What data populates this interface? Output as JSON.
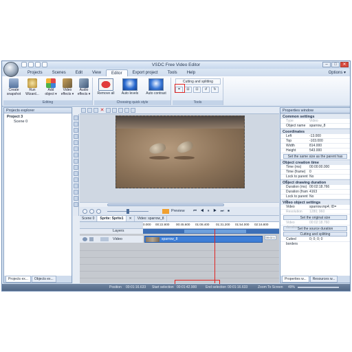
{
  "window": {
    "title": "VSDC Free Video Editor",
    "buttons": [
      "–",
      "□",
      "✕"
    ]
  },
  "menu": {
    "items": [
      "Projects",
      "Scenes",
      "Edit",
      "View",
      "Editor",
      "Export project",
      "Tools",
      "Help"
    ],
    "active": "Editor",
    "options": "Options ▾"
  },
  "ribbon": {
    "editing": {
      "name": "Editing",
      "buttons": [
        "Create snapshot",
        "Run Wizard...",
        "Add object ▾",
        "Video effects ▾",
        "Audio effects ▾"
      ]
    },
    "quick_style": {
      "name": "Choosing quick style",
      "buttons": [
        "Remove all",
        "Auto levels",
        "Auto contrast"
      ]
    },
    "tools": {
      "name": "Tools",
      "cutting": "Cutting and splitting"
    }
  },
  "projects_explorer": {
    "title": "Projects explorer",
    "tree": [
      "Project 3",
      "Scene 0"
    ],
    "tabs": [
      "Projects ex...",
      "Objects ex..."
    ]
  },
  "preview": {
    "label": "Preview"
  },
  "timeline": {
    "tabs": [
      "Scene 0",
      "Sprite: Sprite1",
      "Video: sparrow_8"
    ],
    "ruler": [
      "0.000",
      "00:22.800",
      "00:45.600",
      "01:08.400",
      "01:31.200",
      "01:54.000",
      "02:16.800"
    ],
    "cursor": "00:02:1",
    "layers_label": "Layers",
    "track_label": "Video",
    "clip_name": "sparrow_8"
  },
  "properties": {
    "title": "Properties window",
    "common": {
      "header": "Common settings",
      "rows": [
        {
          "k": "Type",
          "v": "Video",
          "dim": true
        },
        {
          "k": "Object name",
          "v": "sparrow_8",
          "dim": false
        }
      ]
    },
    "coords": {
      "header": "Coordinates",
      "rows": [
        {
          "k": "Left",
          "v": "-13.000"
        },
        {
          "k": "Top",
          "v": "-103.000"
        },
        {
          "k": "Width",
          "v": "814.000"
        },
        {
          "k": "Height",
          "v": "543.000"
        }
      ],
      "button": "Set the same size as the parent has"
    },
    "creation": {
      "header": "Object creation time",
      "rows": [
        {
          "k": "Time (ms)",
          "v": "00:00:00.000"
        },
        {
          "k": "Time (frame)",
          "v": "0"
        },
        {
          "k": "Lock to parent c",
          "v": "No"
        }
      ]
    },
    "duration": {
      "header": "Object drawing duration",
      "rows": [
        {
          "k": "Duration (ms)",
          "v": "00:02:18.766"
        },
        {
          "k": "Duration (fram",
          "v": "4163"
        },
        {
          "k": "Lock to parent c",
          "v": "No"
        }
      ]
    },
    "video": {
      "header": "Video object settings",
      "rows": [
        {
          "k": "Video",
          "v": "sparrow.mp4; ID=",
          "dim": false
        },
        {
          "k": "Resolution",
          "v": "1280; 960",
          "dim": true
        }
      ],
      "btn1": "Set the original size",
      "row2": {
        "k": "Video duration",
        "v": "00:02:18.760"
      },
      "btn2": "Set the source duration",
      "btn3": "Cutting and splitting",
      "row3": {
        "k": "Cutted borders",
        "v": "0; 0; 0; 0"
      }
    },
    "tabs": [
      "Properties w...",
      "Resources w..."
    ]
  },
  "statusbar": {
    "position": "Position",
    "position_val": "00:01:16.633",
    "start_sel": "Start selection",
    "start_val": "00:01:42.900",
    "end_sel": "End selection",
    "end_val": "00:01:16.633",
    "zoom": "Zoom To Screen",
    "zoom_val": "49%"
  }
}
